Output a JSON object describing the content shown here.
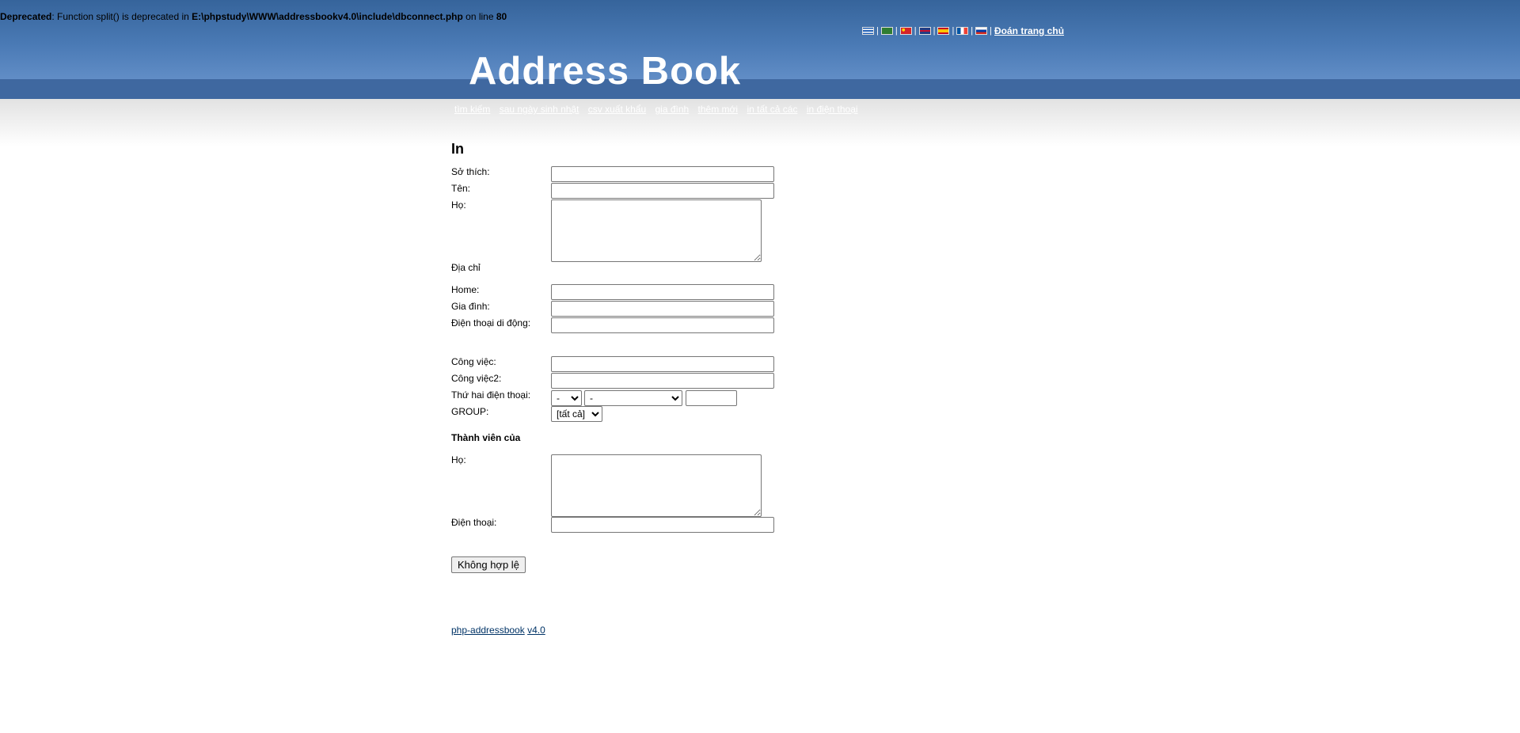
{
  "deprecated": {
    "label": "Deprecated",
    "text": ": Function split() is deprecated in ",
    "path": "E:\\phpstudy\\WWW\\addressbookv4.0\\include\\dbconnect.php",
    "on_line": " on line ",
    "line": "80"
  },
  "langbar": {
    "flags": [
      {
        "name": "greek-flag-icon",
        "colors": [
          "#1f5fb5",
          "#ffffff"
        ]
      },
      {
        "name": "arabic-flag-icon",
        "colors": [
          "#2f7d32",
          "#ffffff"
        ]
      },
      {
        "name": "chinese-flag-icon",
        "colors": [
          "#d3242a",
          "#ffd600"
        ]
      },
      {
        "name": "english-flag-icon",
        "colors": [
          "#223d83",
          "#c8102e"
        ]
      },
      {
        "name": "spanish-flag-icon",
        "colors": [
          "#c60b1e",
          "#ffc400"
        ]
      },
      {
        "name": "french-flag-icon",
        "colors": [
          "#0055a4",
          "#ef4135"
        ]
      },
      {
        "name": "russian-flag-icon",
        "colors": [
          "#ffffff",
          "#0039a6",
          "#d52b1e"
        ]
      }
    ],
    "separator": "|",
    "home_link": "Đoán trang chủ"
  },
  "logo": "Address Book",
  "menu": [
    "tìm kiếm",
    "sau ngày sinh nhật",
    "csv xuất khẩu",
    "gia đình",
    "thêm mới",
    "in tất cả các",
    "in điện thoại"
  ],
  "form": {
    "title": "In",
    "labels": {
      "hobby": "Sở thích:",
      "firstname": "Tên:",
      "lastname": "Họ:",
      "address": "Địa chỉ",
      "home": "Home:",
      "family": "Gia đình:",
      "mobile": "Điện thoại di động:",
      "work": "Công việc:",
      "work2": "Công việc2:",
      "phone2": "Thứ hai điện thoại:",
      "group": "GROUP:",
      "member_of": "Thành viên của",
      "lastname2": "Họ:",
      "phone": "Điện thoại:"
    },
    "values": {
      "hobby": "",
      "firstname": "",
      "lastname": "",
      "home": "",
      "family": "",
      "mobile": "",
      "work": "",
      "work2": "",
      "phone2_text": "",
      "lastname2": "",
      "phone": ""
    },
    "phone2_select1": "-",
    "phone2_select2": "-",
    "group_selected": "[tất cả]",
    "submit_label": "Không hợp lệ"
  },
  "footer": {
    "project": "php-addressbook",
    "version": "v4.0"
  },
  "colors": {
    "header_dark": "#36649b",
    "header_light": "#6d97cf",
    "nav_band": "#3f68a0",
    "link_dark": "#003366"
  }
}
